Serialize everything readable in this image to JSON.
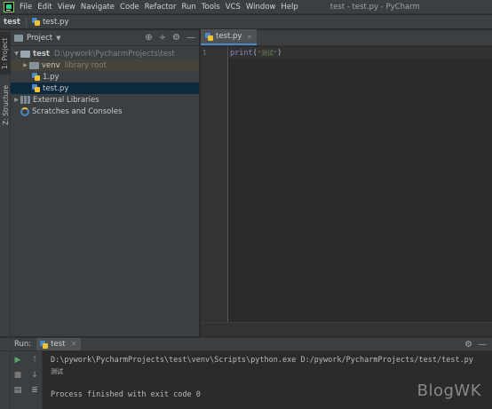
{
  "menu": {
    "items": [
      "File",
      "Edit",
      "View",
      "Navigate",
      "Code",
      "Refactor",
      "Run",
      "Tools",
      "VCS",
      "Window",
      "Help"
    ],
    "window_title": "test - test.py - PyCharm"
  },
  "navbar": {
    "project": "test",
    "file": "test.py"
  },
  "left_stripe": {
    "project_tab": "1: Project",
    "structure_tab": "Z: Structure"
  },
  "project_panel": {
    "title": "Project",
    "tree": {
      "root_name": "test",
      "root_path": "D:\\pywork\\PycharmProjects\\test",
      "venv_name": "venv",
      "venv_hint": "library root",
      "file1": "1.py",
      "file2": "test.py",
      "external_libraries": "External Libraries",
      "scratches": "Scratches and Consoles"
    }
  },
  "editor": {
    "tab_label": "test.py",
    "line_number": "1",
    "code": {
      "fn": "print",
      "open": "(",
      "str": "\"测试\"",
      "close": ")"
    }
  },
  "run_panel": {
    "label": "Run:",
    "tab": "test",
    "lines": [
      "D:\\pywork\\PycharmProjects\\test\\venv\\Scripts\\python.exe D:/pywork/PycharmProjects/test/test.py",
      "测试",
      "",
      "Process finished with exit code 0"
    ]
  },
  "watermark": "BlogWK",
  "colors": {
    "selection": "#0d293e",
    "accent": "#4a88c7",
    "run_green": "#59a869"
  }
}
